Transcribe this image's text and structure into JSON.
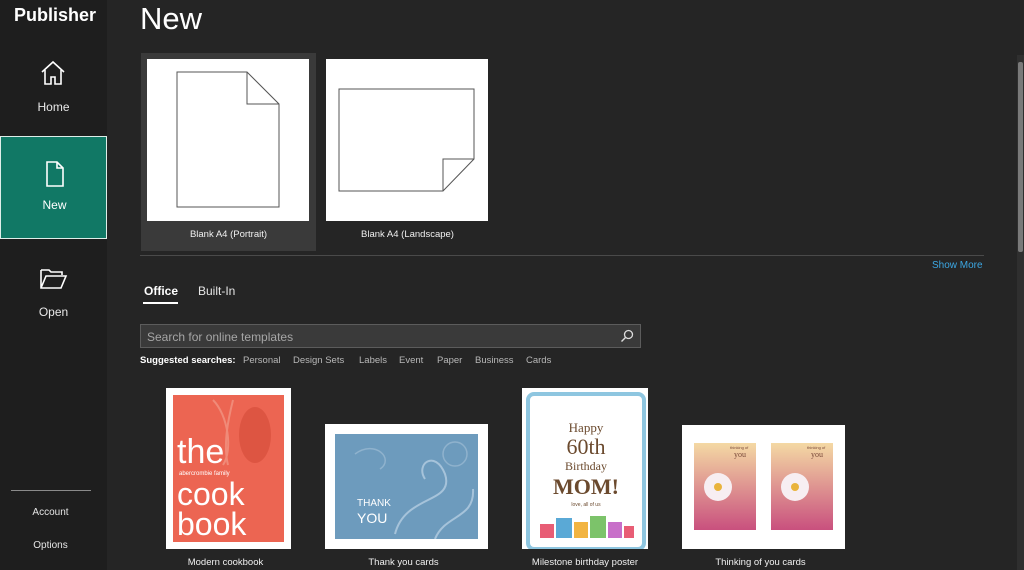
{
  "app": {
    "title": "Publisher"
  },
  "sidebar": {
    "items": [
      {
        "label": "Home",
        "icon": "home-icon"
      },
      {
        "label": "New",
        "icon": "new-document-icon"
      },
      {
        "label": "Open",
        "icon": "folder-open-icon"
      }
    ],
    "bottom": [
      {
        "label": "Account"
      },
      {
        "label": "Options"
      }
    ]
  },
  "main": {
    "title": "New"
  },
  "blank_templates": [
    {
      "label": "Blank A4 (Portrait)"
    },
    {
      "label": "Blank A4 (Landscape)"
    }
  ],
  "show_more": "Show More",
  "tabs": [
    {
      "label": "Office",
      "selected": true
    },
    {
      "label": "Built-In",
      "selected": false
    }
  ],
  "search": {
    "placeholder": "Search for online templates"
  },
  "suggested": {
    "lead": "Suggested searches:",
    "items": [
      "Personal",
      "Design Sets",
      "Labels",
      "Event",
      "Paper",
      "Business",
      "Cards"
    ]
  },
  "templates": [
    {
      "label": "Modern cookbook",
      "thumb": {
        "line1": "the",
        "small": "abercrombie family",
        "line2": "cook",
        "line3": "book"
      }
    },
    {
      "label": "Thank you cards",
      "thumb": {
        "line1": "THANK",
        "line2": "YOU"
      }
    },
    {
      "label": "Milestone birthday poster",
      "thumb": {
        "line1": "Happy",
        "line2": "60th",
        "line3": "Birthday",
        "line4": "MOM!",
        "small": "love, all of us"
      }
    },
    {
      "label": "Thinking of you cards",
      "thumb": {
        "line1": "thinking of",
        "line2": "you"
      }
    }
  ],
  "colors": {
    "accent": "#117865",
    "link": "#3ca7e3",
    "background": "#252525",
    "sidebar": "#1e1e1e"
  }
}
